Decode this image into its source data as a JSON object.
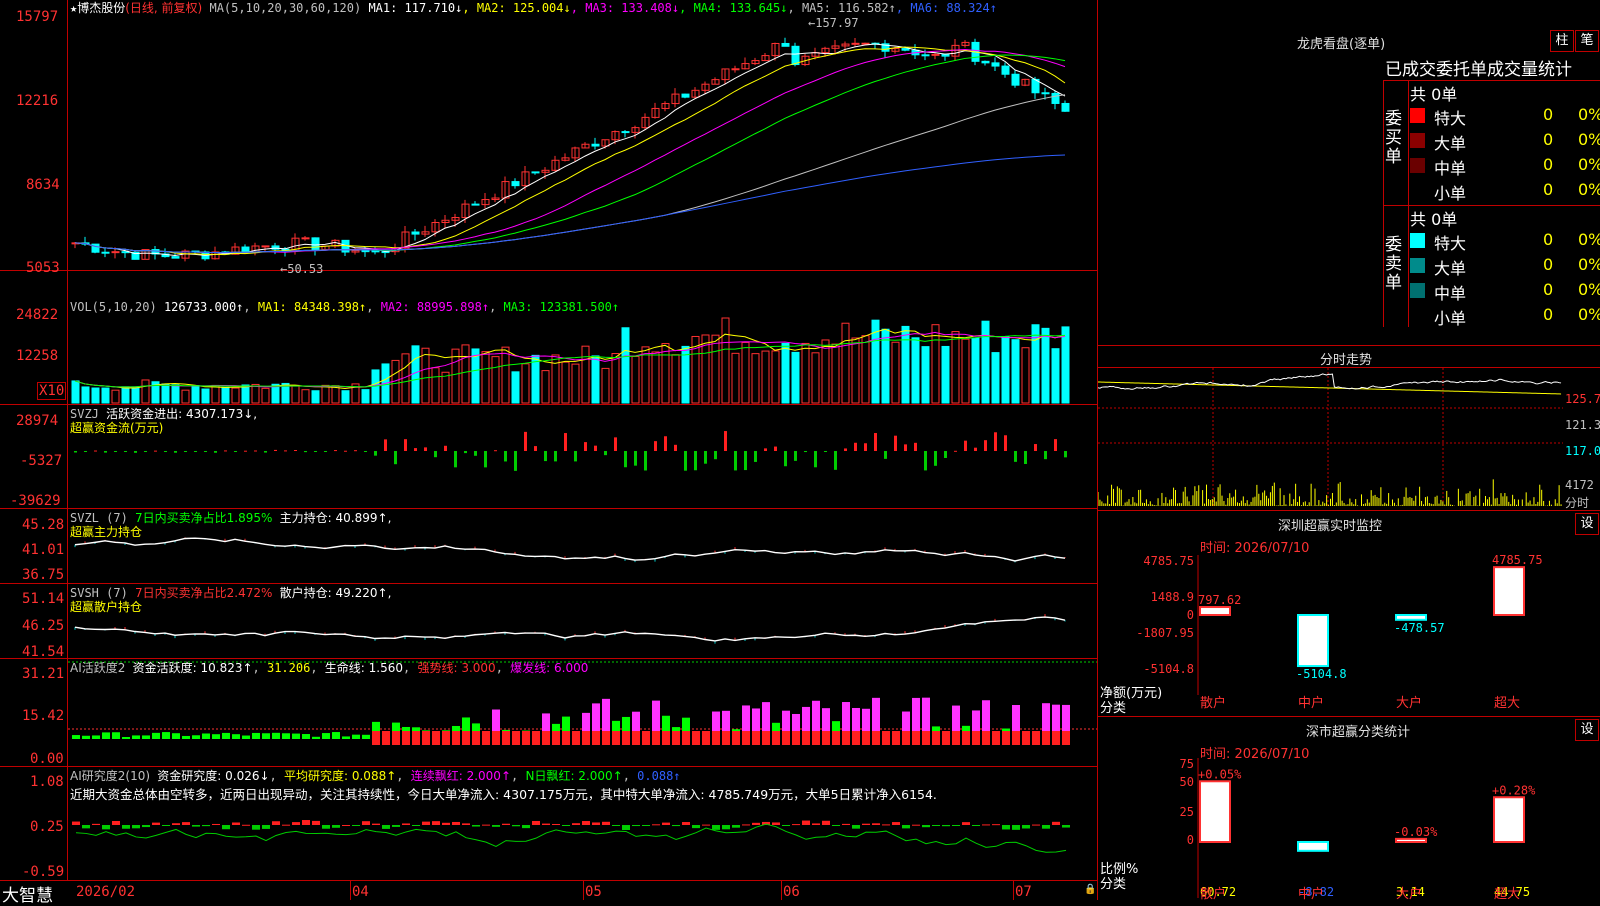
{
  "colors": {
    "up": "#ff3232",
    "down": "#00ffff",
    "ma1": "#ffffff",
    "ma2": "#ffff00",
    "ma3": "#ff00ff",
    "ma4": "#00ff00",
    "ma5": "#c0c0c0",
    "ma6": "#3060ff",
    "grid": "#c00000"
  },
  "header": {
    "star": "★",
    "stock_name": "博杰股份",
    "period": "(日线, 前复权)",
    "ma_label": "MA(5,10,20,30,60,120)",
    "ma1": "MA1: 117.710↓",
    "ma2": "MA2: 125.004↓",
    "ma3": "MA3: 133.408↓",
    "ma4": "MA4: 133.645↓",
    "ma5": "MA5: 116.582↑",
    "ma6": "MA6: 88.324↑"
  },
  "price_panel": {
    "y_labels": [
      "15797",
      "12216",
      "8634",
      "5053"
    ],
    "high_mark": "157.97",
    "low_mark": "50.53"
  },
  "vol_panel": {
    "title": "VOL(5,10,20)",
    "value": "126733.000↑",
    "ma1": "MA1: 84348.398↑",
    "ma2": "MA2: 88995.898↑",
    "ma3": "MA3: 123381.500↑",
    "y_labels": [
      "24822",
      "12258"
    ],
    "unit": "X10"
  },
  "svzj_panel": {
    "title": "SVZJ",
    "line1": "活跃资金进出: 4307.173↓,",
    "line2": "超赢资金流(万元)",
    "y_labels": [
      "28974",
      "-5327",
      "-39629"
    ]
  },
  "svzl_panel": {
    "title": "SVZL (7)",
    "ratio": "7日内买卖净占比1.895%",
    "hold": "主力持仓: 40.899↑,",
    "line2": "超赢主力持仓",
    "y_labels": [
      "45.28",
      "41.01",
      "36.75"
    ]
  },
  "svsh_panel": {
    "title": "SVSH (7)",
    "ratio": "7日内买卖净占比2.472%",
    "hold": "散户持仓: 49.220↑,",
    "line2": "超赢散户持仓",
    "y_labels": [
      "51.14",
      "46.25",
      "41.54"
    ]
  },
  "ai_active": {
    "title": "AI活跃度2",
    "v1": "资金活跃度: 10.823↑",
    "v2": "31.206",
    "v3": "生命线: 1.560",
    "v4": "强势线: 3.000",
    "v5": "爆发线: 6.000",
    "y_labels": [
      "31.21",
      "15.42",
      "0.00"
    ]
  },
  "ai_research": {
    "title": "AI研究度2(10)",
    "v1": "资金研究度: 0.026↓",
    "v2": "平均研究度: 0.088↑",
    "v3": "连续飘红: 2.000↑",
    "v4": "N日飘红: 2.000↑",
    "v5": "0.088↑",
    "note": "近期大资金总体由空转多，近两日出现异动，关注其持续性，今日大单净流入: 4307.175万元，其中特大单净流入: 4785.749万元，大单5日累计净入6154.",
    "y_labels": [
      "1.08",
      "0.25",
      "-0.59"
    ]
  },
  "xaxis": {
    "brand": "大智慧",
    "labels": [
      "2026/02",
      "04",
      "05",
      "06",
      "07"
    ]
  },
  "dragon": {
    "title": "龙虎看盘(逐单)",
    "btn1": "柱",
    "btn2": "笔",
    "subtitle": "已成交委托单成交量统计",
    "buy_label": "委买单",
    "sell_label": "委卖单",
    "buy_total": "共 0单",
    "sell_total": "共 0单",
    "buy_rows": [
      {
        "name": "特大",
        "vol": "0",
        "pct": "0%",
        "color": "#ff0000"
      },
      {
        "name": "大单",
        "vol": "0",
        "pct": "0%",
        "color": "#8b0000"
      },
      {
        "name": "中单",
        "vol": "0",
        "pct": "0%",
        "color": "#6a0000"
      },
      {
        "name": "小单",
        "vol": "0",
        "pct": "0%",
        "color": ""
      }
    ],
    "sell_rows": [
      {
        "name": "特大",
        "vol": "0",
        "pct": "0%",
        "color": "#00ffff"
      },
      {
        "name": "大单",
        "vol": "0",
        "pct": "0%",
        "color": "#008b8b"
      },
      {
        "name": "中单",
        "vol": "0",
        "pct": "0%",
        "color": "#007070"
      },
      {
        "name": "小单",
        "vol": "0",
        "pct": "0%",
        "color": ""
      }
    ]
  },
  "intraday": {
    "title": "分时走势",
    "labels": [
      "125.7",
      "121.3",
      "117.0",
      "4172",
      "分时"
    ]
  },
  "sz_monitor": {
    "title": "深圳超赢实时监控",
    "btn": "设",
    "date": "时间: 2026/07/10",
    "y_labels": [
      "4785.75",
      "1488.9",
      "0",
      "-1807.95",
      "-5104.8"
    ],
    "axis_name": "净额(万元)",
    "axis_cat": "分类",
    "bars": [
      {
        "cat": "散户",
        "value": 797.62,
        "label": "797.62"
      },
      {
        "cat": "中户",
        "value": -5104.8,
        "label": "-5104.8"
      },
      {
        "cat": "大户",
        "value": -478.57,
        "label": "-478.57"
      },
      {
        "cat": "超大",
        "value": 4785.75,
        "label": "4785.75"
      }
    ]
  },
  "sz_class": {
    "title": "深市超赢分类统计",
    "btn": "设",
    "date": "时间: 2026/07/10",
    "y_labels": [
      "75",
      "50",
      "25",
      "0"
    ],
    "axis_name": "比例%",
    "axis_cat": "分类",
    "bars": [
      {
        "cat": "散户",
        "pct": 60.72,
        "bottom": "60.72",
        "top": "+0.05%"
      },
      {
        "cat": "中户",
        "pct": -8.82,
        "bottom": "-8.82",
        "top": ""
      },
      {
        "cat": "大户",
        "pct": 3.14,
        "bottom": "3.14",
        "top": "-0.03%"
      },
      {
        "cat": "超大",
        "pct": 44.75,
        "bottom": "44.75",
        "top": "+0.28%"
      }
    ]
  }
}
